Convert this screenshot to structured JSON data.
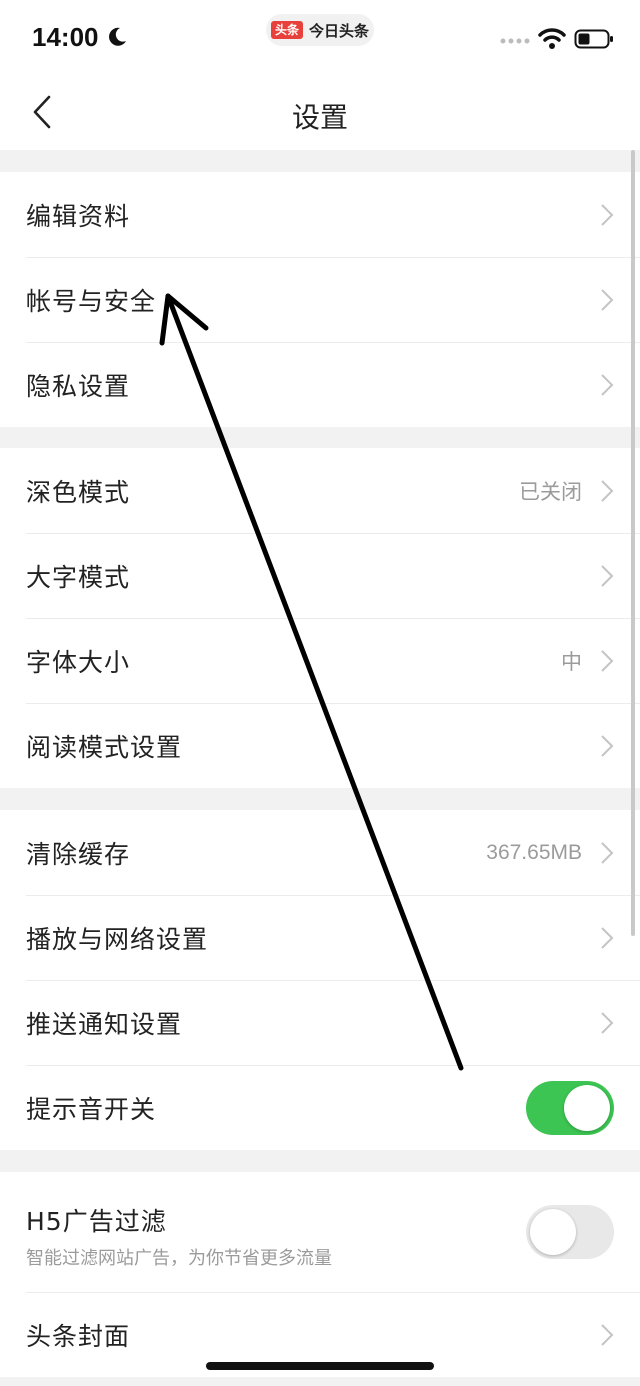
{
  "status_bar": {
    "time": "14:00",
    "app_logo": "头条",
    "app_name": "今日头条"
  },
  "nav": {
    "title": "设置"
  },
  "groups": [
    {
      "rows": [
        {
          "label": "编辑资料"
        },
        {
          "label": "帐号与安全"
        },
        {
          "label": "隐私设置"
        }
      ]
    },
    {
      "rows": [
        {
          "label": "深色模式",
          "value": "已关闭"
        },
        {
          "label": "大字模式"
        },
        {
          "label": "字体大小",
          "value": "中"
        },
        {
          "label": "阅读模式设置"
        }
      ]
    },
    {
      "rows": [
        {
          "label": "清除缓存",
          "value": "367.65MB"
        },
        {
          "label": "播放与网络设置"
        },
        {
          "label": "推送通知设置"
        },
        {
          "label": "提示音开关",
          "toggle": true
        }
      ]
    },
    {
      "rows": [
        {
          "label": "H5广告过滤",
          "sublabel": "智能过滤网站广告，为你节省更多流量",
          "toggle": false
        },
        {
          "label": "头条封面"
        }
      ]
    }
  ],
  "colors": {
    "toggle_on": "#3cc552",
    "toggle_off": "#e8e8e8",
    "app_logo_red": "#e8403a",
    "background": "#f2f2f2"
  },
  "icons": [
    "moon-icon",
    "wifi-icon",
    "battery-icon",
    "back-arrow-icon",
    "chevron-right-icon"
  ]
}
